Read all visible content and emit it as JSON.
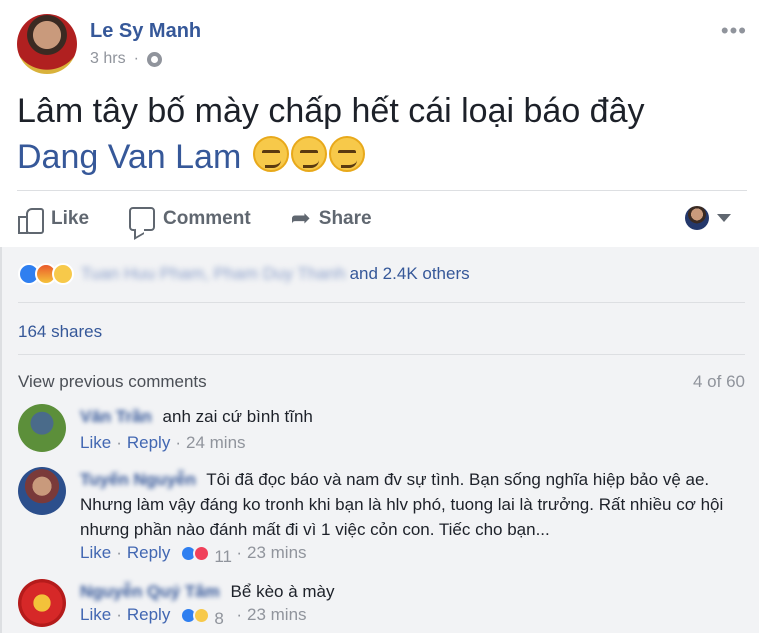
{
  "post": {
    "author": "Le Sy Manh",
    "time": "3 hrs",
    "more": "•••",
    "text": "Lâm tây bố mày chấp hết cái loại báo đây",
    "mention": "Dang Van Lam",
    "emoji": [
      "smirk-emoji",
      "smirk-emoji",
      "smirk-emoji"
    ]
  },
  "actions": {
    "like": "Like",
    "comment": "Comment",
    "share": "Share"
  },
  "feedback": {
    "reacted_names": "Tuan Huu Pham, Pham Duy Thanh",
    "reacted_others": "and 2.4K others",
    "shares": "164 shares",
    "view_previous": "View previous comments",
    "counter": "4 of 60"
  },
  "comments": [
    {
      "name": "Văn Trần",
      "text": "anh zai cứ bình tĩnh",
      "like": "Like",
      "reply": "Reply",
      "time": "24 mins",
      "reaction_count": ""
    },
    {
      "name": "Tuyến Nguyễn",
      "text": "Tôi đã đọc báo và nam đv sự tình. Bạn sống nghĩa hiệp bảo vệ ae. Nhưng làm vậy đáng ko tronh khi bạn là hlv phó, tuong lai là trưởng. Rất nhiều cơ hội nhưng phần nào đánh mất đi vì 1 việc cỏn con. Tiếc cho bạn...",
      "like": "Like",
      "reply": "Reply",
      "time": "23 mins",
      "reaction_count": "11"
    },
    {
      "name": "Nguyễn Quý Tâm",
      "text": "Bể kèo à mày",
      "like": "Like",
      "reply": "Reply",
      "time": "23 mins",
      "reaction_count": "8"
    }
  ],
  "colors": {
    "link": "#365899",
    "muted": "#90949c",
    "feedback_bg": "#f2f3f5"
  }
}
